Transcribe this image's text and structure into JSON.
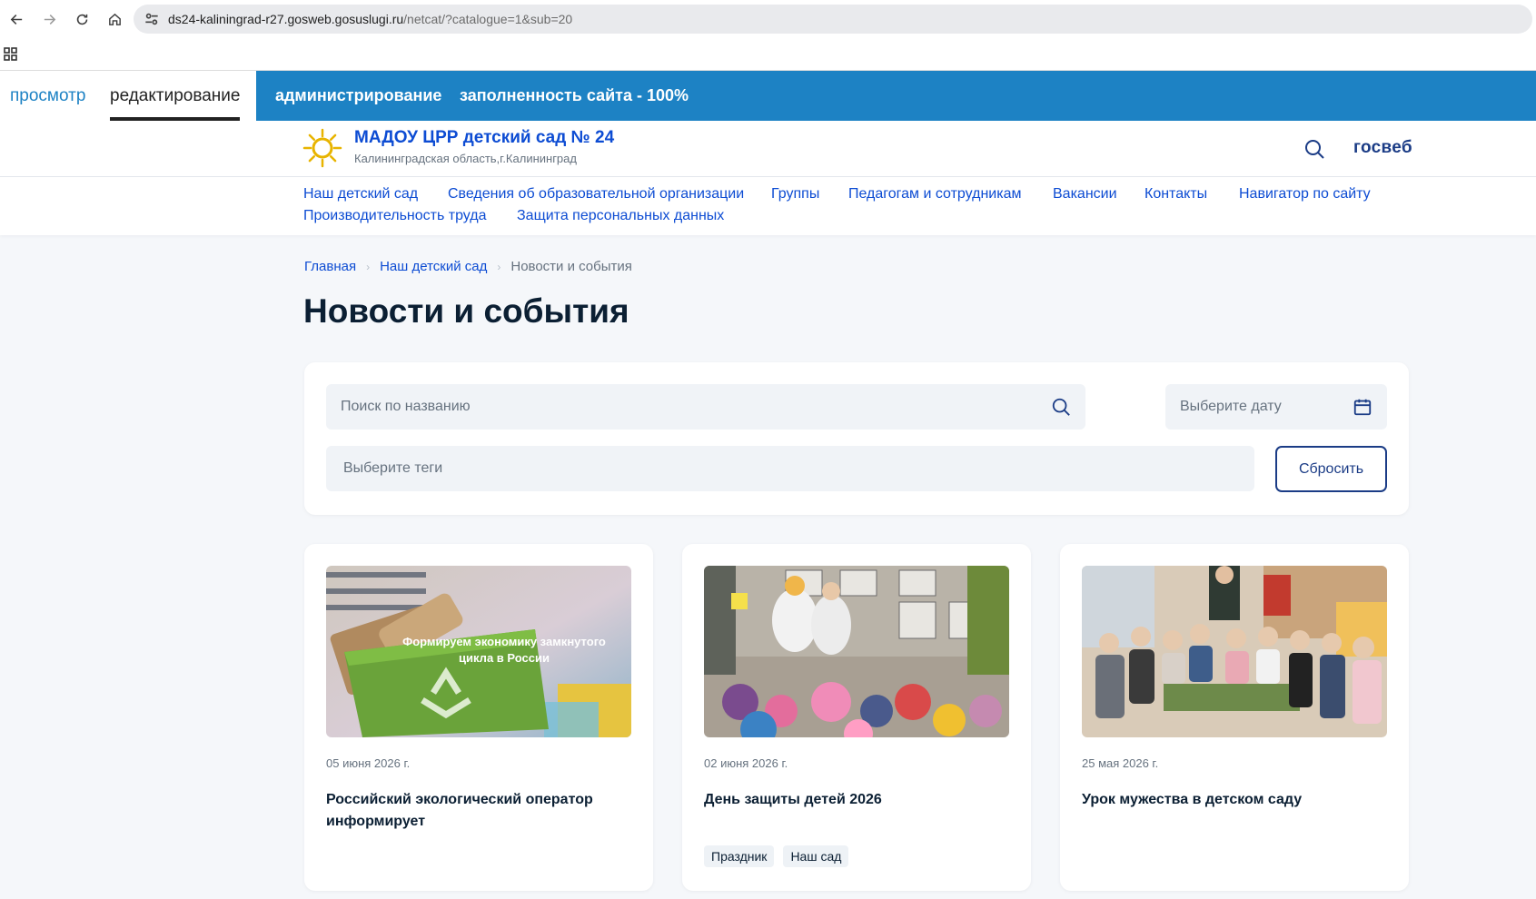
{
  "browser": {
    "url_host": "ds24-kaliningrad-r27.gosweb.gosuslugi.ru",
    "url_path": "/netcat/?catalogue=1&sub=20"
  },
  "admin": {
    "view_label": "просмотр",
    "edit_label": "редактирование",
    "admin_label": "администрирование",
    "fill_label": "заполненность сайта - 100%"
  },
  "header": {
    "org_name": "МАДОУ ЦРР детский сад № 24",
    "org_region": "Калининградская область,г.Калининград",
    "platform_logo": "госвеб"
  },
  "nav": {
    "items": [
      "Наш детский сад",
      "Сведения об образовательной организации",
      "Группы",
      "Педагогам и сотрудникам",
      "Вакансии",
      "Контакты",
      "Навигатор по сайту",
      "Производительность труда",
      "Защита персональных данных"
    ]
  },
  "breadcrumbs": [
    "Главная",
    "Наш детский сад",
    "Новости и события"
  ],
  "page_title": "Новости и события",
  "filters": {
    "search_placeholder": "Поиск по названию",
    "date_placeholder": "Выберите дату",
    "tags_placeholder": "Выберите теги",
    "reset_label": "Сбросить"
  },
  "news": [
    {
      "date": "05 июня 2026 г.",
      "title": "Российский экологический оператор информирует",
      "image_caption": "Формируем экономику замкнутого цикла в России",
      "tags": []
    },
    {
      "date": "02 июня 2026 г.",
      "title": "День защиты детей 2026",
      "tags": [
        "Праздник",
        "Наш сад"
      ]
    },
    {
      "date": "25 мая 2026 г.",
      "title": "Урок мужества в детском саду",
      "tags": []
    }
  ],
  "colors": {
    "admin_blue": "#1d82c4",
    "link_blue": "#0d4cd3",
    "dark_blue": "#1b3c86",
    "text": "#0b1f33",
    "muted": "#66727f",
    "page_bg": "#f5f7fa"
  },
  "icons": {
    "back": "arrow-left-icon",
    "forward": "arrow-right-icon",
    "reload": "reload-icon",
    "home": "home-icon",
    "site_settings": "tune-icon",
    "apps": "apps-grid-icon",
    "logo": "sun-logo-icon",
    "search": "search-icon",
    "calendar": "calendar-icon"
  }
}
